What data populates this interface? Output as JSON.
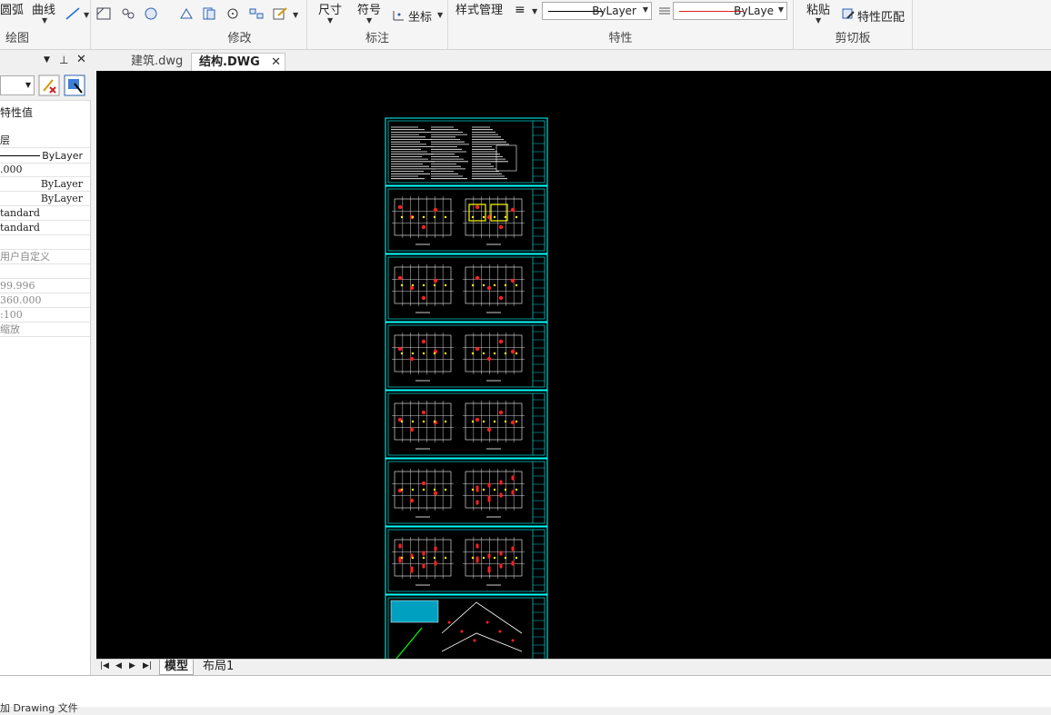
{
  "ribbon": {
    "draw_group": {
      "label": "绘图",
      "arc": "圆弧",
      "curve": "曲线"
    },
    "modify_group": {
      "label": "修改"
    },
    "annotate_group": {
      "label": "标注",
      "dimension": "尺寸",
      "symbol": "符号",
      "coordinate": "坐标"
    },
    "properties_group": {
      "label": "特性",
      "style_manager": "样式管理",
      "linetype_value": "ByLayer",
      "color_value": "ByLaye",
      "linetype_color": "#000000",
      "color_line_color": "#e02020"
    },
    "clipboard_group": {
      "label": "剪切板",
      "paste": "粘贴",
      "match_props": "特性匹配"
    }
  },
  "doc_tabs": [
    {
      "label": "建筑.dwg",
      "active": false
    },
    {
      "label": "结构.DWG",
      "active": true
    }
  ],
  "property_panel": {
    "header": "特性值",
    "rows": [
      "层",
      "ByLayer",
      ".000",
      "ByLayer",
      "ByLayer",
      "tandard",
      "tandard",
      "",
      "用户自定义",
      "",
      "99.996",
      "360.000",
      ":100",
      "缩放"
    ]
  },
  "layout_tabs": [
    {
      "label": "模型",
      "active": true
    },
    {
      "label": "布局1",
      "active": false
    }
  ],
  "command_line": "加 Drawing 文件",
  "colors": {
    "canvas": "#000000",
    "frame": "#00ffff",
    "dim": "#ff2020",
    "annotation": "#ffff00"
  }
}
